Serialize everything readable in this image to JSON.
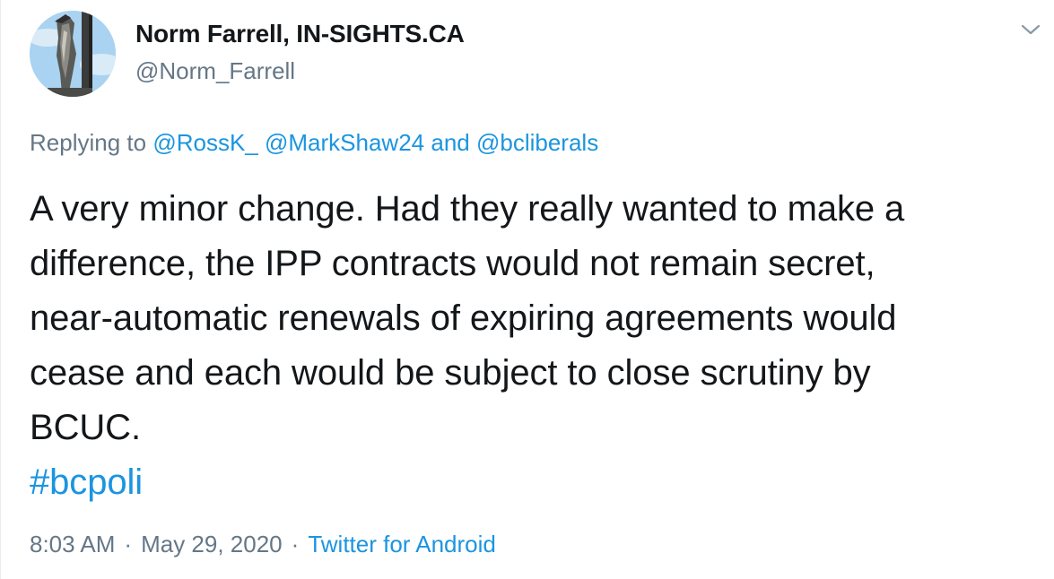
{
  "author": {
    "display_name": "Norm Farrell, IN-SIGHTS.CA",
    "handle": "@Norm_Farrell",
    "avatar_icon": "avatar-photo"
  },
  "reply": {
    "prefix": "Replying to",
    "mention_1": "@RossK_",
    "mention_2": "@MarkShaw24",
    "conjunction": "and",
    "mention_3": "@bcliberals"
  },
  "tweet": {
    "lines": [
      "A very minor change. Had they really wanted to make a",
      "difference, the IPP contracts would not remain secret,",
      "near-automatic renewals of expiring agreements would",
      "cease and each would be subject to close scrutiny by",
      "BCUC."
    ],
    "hashtag": "#bcpoli"
  },
  "meta": {
    "time": "8:03 AM",
    "separator": "·",
    "date": "May 29, 2020",
    "source": "Twitter for Android"
  },
  "colors": {
    "link": "#1b95e0",
    "secondary_text": "#657786",
    "primary_text": "#14171a"
  },
  "icons": {
    "more_menu": "chevron-down-icon"
  }
}
